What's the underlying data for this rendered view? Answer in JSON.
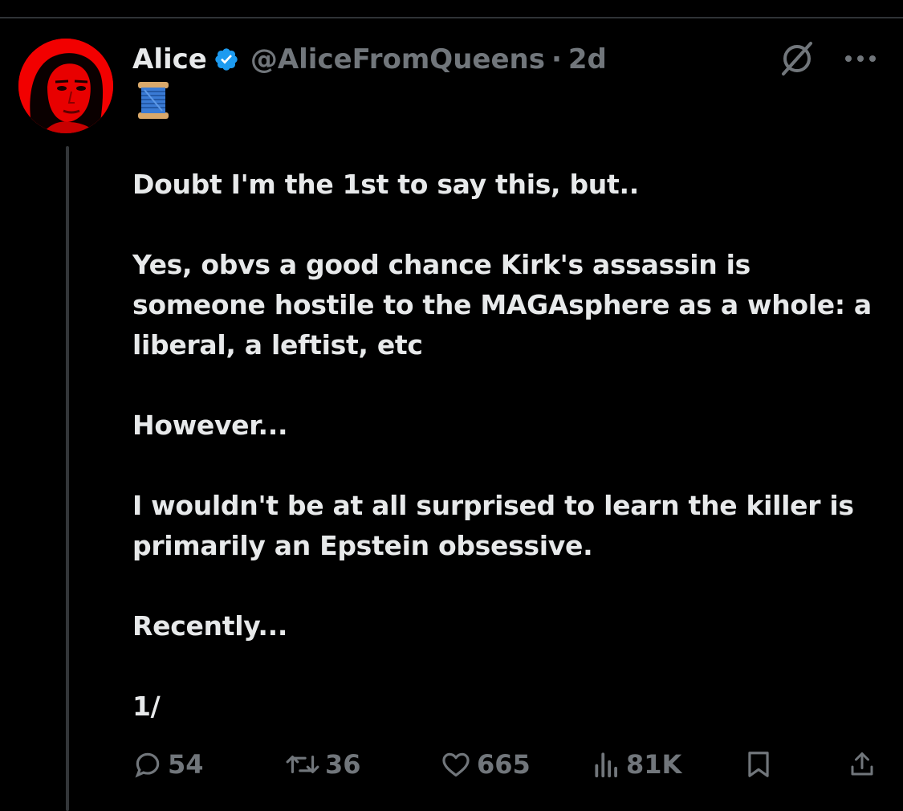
{
  "tweet": {
    "author_name": "Alice",
    "handle": "@AliceFromQueens",
    "separator": "·",
    "time": "2d",
    "verified": true,
    "accent_color": "#1d9bf0",
    "avatar_color": "#f20000",
    "lead_emoji": "spool-of-thread-icon",
    "paragraphs": [
      "Doubt I'm the 1st to say this, but..",
      "Yes, obvs a good chance Kirk's assassin is someone hostile to the MAGAsphere as a whole: a liberal, a leftist, etc",
      "However...",
      "I wouldn't be at all surprised to learn the killer is primarily an Epstein obsessive.",
      "Recently...",
      "1/"
    ]
  },
  "actions": {
    "replies": "54",
    "reposts": "36",
    "likes": "665",
    "views": "81K"
  },
  "icons": {
    "header": [
      "verified-badge-icon",
      "grok-icon",
      "more-icon"
    ],
    "actions": [
      "reply-icon",
      "repost-icon",
      "like-icon",
      "views-icon",
      "bookmark-icon",
      "share-icon"
    ]
  }
}
